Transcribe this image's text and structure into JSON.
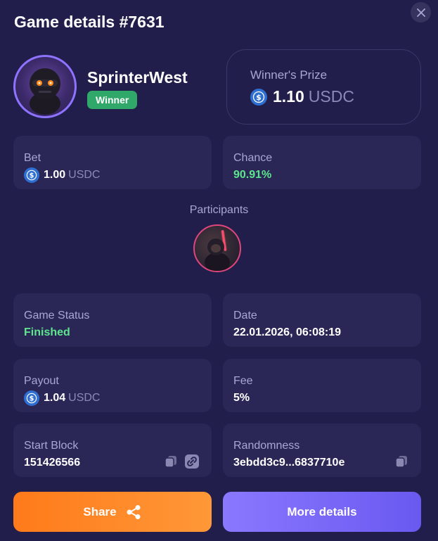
{
  "header": {
    "title": "Game details #7631"
  },
  "winner": {
    "name": "SprinterWest",
    "badge": "Winner"
  },
  "prize": {
    "label": "Winner's Prize",
    "amount": "1.10",
    "currency": "USDC"
  },
  "bet": {
    "label": "Bet",
    "amount": "1.00",
    "currency": "USDC"
  },
  "chance": {
    "label": "Chance",
    "value": "90.91%"
  },
  "participants": {
    "label": "Participants"
  },
  "status": {
    "label": "Game Status",
    "value": "Finished"
  },
  "date": {
    "label": "Date",
    "value": "22.01.2026, 06:08:19"
  },
  "payout": {
    "label": "Payout",
    "amount": "1.04",
    "currency": "USDC"
  },
  "fee": {
    "label": "Fee",
    "value": "5%"
  },
  "start_block": {
    "label": "Start Block",
    "value": "151426566"
  },
  "randomness": {
    "label": "Randomness",
    "value": "3ebdd3c9...6837710e"
  },
  "actions": {
    "share_label": "Share",
    "more_label": "More details"
  },
  "colors": {
    "accent_green": "#5de68d",
    "share_orange": "#ff7a1a",
    "more_purple": "#7b69fa",
    "usdc_blue": "#2f6fd1"
  }
}
